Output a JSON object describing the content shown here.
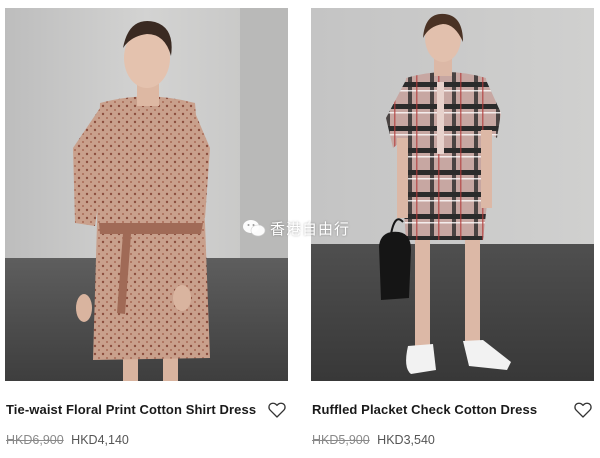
{
  "products": [
    {
      "title": "Tie-waist Floral Print Cotton Shirt Dress",
      "original_price": "HKD6,900",
      "sale_price": "HKD4,140",
      "wishlist_icon": "heart-outline-icon"
    },
    {
      "title": "Ruffled Placket Check Cotton Dress",
      "original_price": "HKD5,900",
      "sale_price": "HKD3,540",
      "wishlist_icon": "heart-outline-icon"
    }
  ],
  "watermark": {
    "icon": "wechat-icon",
    "text": "香港自由行"
  },
  "colors": {
    "text": "#1a1a1a",
    "price_muted": "#8a8a8a",
    "price": "#555555",
    "background": "#ffffff"
  }
}
